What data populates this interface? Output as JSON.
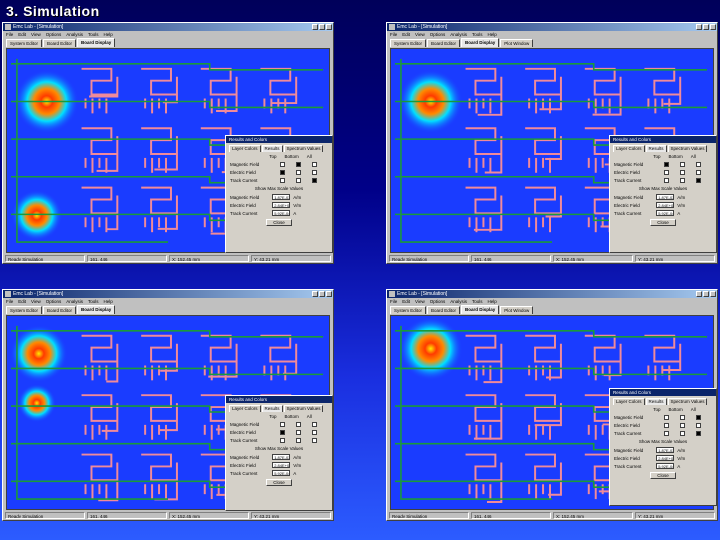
{
  "slide": {
    "title": "3. Simulation"
  },
  "colors": {
    "pcb_background": "#1a3cff",
    "trace_pink": "#f08a9a",
    "trace_green": "#1a9a3a",
    "hotspot_core": "#ffea00",
    "hotspot_mid": "#ff3a00",
    "hotspot_halo": "#00e0ff"
  },
  "windows": [
    {
      "title": "Emc Lab - [Simulation]",
      "menus": [
        "File",
        "Edit",
        "View",
        "Options",
        "Analysis",
        "Tools",
        "Help"
      ],
      "tabs": [
        "System Editor",
        "Board Editor",
        "Board Display"
      ],
      "active_tab": 2,
      "status": [
        "Ready  Simulation",
        "161, 446",
        "X: 152.45 mm",
        "Y: 43.21 mm"
      ],
      "dialog": {
        "title": "Results and Colors",
        "tabs": [
          "Layer Colors",
          "Results",
          "Spectrum Values"
        ],
        "col_headers": [
          "Top",
          "Bottom",
          "All"
        ],
        "rows": [
          {
            "label": "Magnetic Field",
            "checks": [
              false,
              true,
              false
            ]
          },
          {
            "label": "Electric Field",
            "checks": [
              true,
              false,
              false
            ]
          },
          {
            "label": "Track Current",
            "checks": [
              false,
              false,
              true
            ]
          }
        ],
        "group_label": "Show Max Scale Values",
        "values": [
          {
            "label": "Magnetic Field",
            "value": "1.87E-03",
            "unit": "A/m"
          },
          {
            "label": "Electric Field",
            "value": "2.84E+01",
            "unit": "V/m"
          },
          {
            "label": "Track Current",
            "value": "5.92E-04",
            "unit": "A"
          }
        ],
        "close_label": "Close"
      }
    },
    {
      "title": "Emc Lab - [Simulation]",
      "menus": [
        "File",
        "Edit",
        "View",
        "Options",
        "Analysis",
        "Tools",
        "Help"
      ],
      "tabs": [
        "System Editor",
        "Board Editor",
        "Board Display",
        "Plot Window"
      ],
      "active_tab": 2,
      "status": [
        "Ready  Simulation",
        "161, 446",
        "X: 152.45 mm",
        "Y: 43.21 mm"
      ],
      "dialog": {
        "title": "Results and Colors",
        "tabs": [
          "Layer Colors",
          "Results",
          "Spectrum Values"
        ],
        "col_headers": [
          "Top",
          "Bottom",
          "All"
        ],
        "rows": [
          {
            "label": "Magnetic Field",
            "checks": [
              true,
              false,
              false
            ]
          },
          {
            "label": "Electric Field",
            "checks": [
              false,
              false,
              false
            ]
          },
          {
            "label": "Track Current",
            "checks": [
              false,
              false,
              true
            ]
          }
        ],
        "group_label": "Show Max Scale Values",
        "values": [
          {
            "label": "Magnetic Field",
            "value": "1.87E-03",
            "unit": "A/m"
          },
          {
            "label": "Electric Field",
            "value": "2.84E+01",
            "unit": "V/m"
          },
          {
            "label": "Track Current",
            "value": "5.92E-04",
            "unit": "A"
          }
        ],
        "close_label": "Close"
      }
    },
    {
      "title": "Emc Lab - [Simulation]",
      "menus": [
        "File",
        "Edit",
        "View",
        "Options",
        "Analysis",
        "Tools",
        "Help"
      ],
      "tabs": [
        "System Editor",
        "Board Editor",
        "Board Display"
      ],
      "active_tab": 2,
      "status": [
        "Ready  Simulation",
        "161, 446",
        "X: 152.45 mm",
        "Y: 43.21 mm"
      ],
      "dialog": {
        "title": "Results and Colors",
        "tabs": [
          "Layer Colors",
          "Results",
          "Spectrum Values"
        ],
        "col_headers": [
          "Top",
          "Bottom",
          "All"
        ],
        "rows": [
          {
            "label": "Magnetic Field",
            "checks": [
              false,
              false,
              false
            ]
          },
          {
            "label": "Electric Field",
            "checks": [
              true,
              false,
              false
            ]
          },
          {
            "label": "Track Current",
            "checks": [
              false,
              false,
              false
            ]
          }
        ],
        "group_label": "Show Max Scale Values",
        "values": [
          {
            "label": "Magnetic Field",
            "value": "1.87E-03",
            "unit": "A/m"
          },
          {
            "label": "Electric Field",
            "value": "2.84E+01",
            "unit": "V/m"
          },
          {
            "label": "Track Current",
            "value": "5.92E-04",
            "unit": "A"
          }
        ],
        "close_label": "Close"
      }
    },
    {
      "title": "Emc Lab - [Simulation]",
      "menus": [
        "File",
        "Edit",
        "View",
        "Options",
        "Analysis",
        "Tools",
        "Help"
      ],
      "tabs": [
        "System Editor",
        "Board Editor",
        "Board Display",
        "Plot Window"
      ],
      "active_tab": 2,
      "status": [
        "Ready  Simulation",
        "161, 446",
        "X: 152.45 mm",
        "Y: 43.21 mm"
      ],
      "dialog": {
        "title": "Results and Colors",
        "tabs": [
          "Layer Colors",
          "Results",
          "Spectrum Values"
        ],
        "col_headers": [
          "Top",
          "Bottom",
          "All"
        ],
        "rows": [
          {
            "label": "Magnetic Field",
            "checks": [
              false,
              false,
              true
            ]
          },
          {
            "label": "Electric Field",
            "checks": [
              false,
              false,
              false
            ]
          },
          {
            "label": "Track Current",
            "checks": [
              false,
              false,
              true
            ]
          }
        ],
        "group_label": "Show Max Scale Values",
        "values": [
          {
            "label": "Magnetic Field",
            "value": "1.87E-03",
            "unit": "A/m"
          },
          {
            "label": "Electric Field",
            "value": "2.84E+01",
            "unit": "V/m"
          },
          {
            "label": "Track Current",
            "value": "5.92E-04",
            "unit": "A"
          }
        ],
        "close_label": "Close"
      }
    }
  ]
}
